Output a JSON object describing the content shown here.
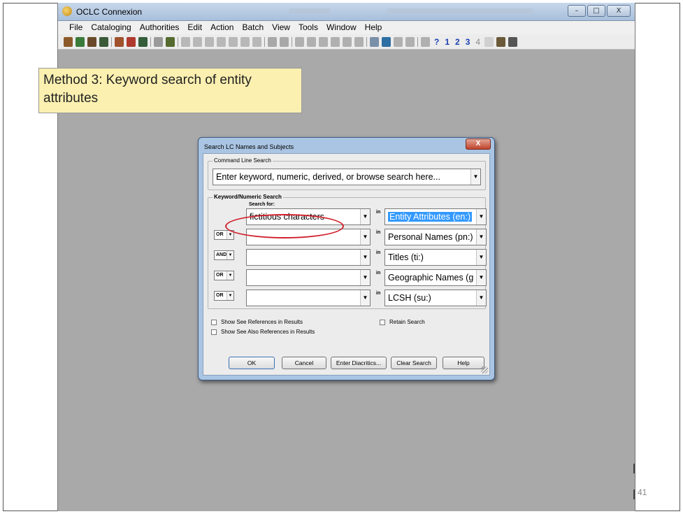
{
  "window": {
    "title": "OCLC Connexion",
    "menu": [
      "File",
      "Cataloging",
      "Authorities",
      "Edit",
      "Action",
      "Batch",
      "View",
      "Tools",
      "Window",
      "Help"
    ],
    "toolbar_numbers": [
      "?",
      "1",
      "2",
      "3",
      "4"
    ],
    "min_label": "–",
    "max_label": "□",
    "close_label": "X"
  },
  "callout": {
    "text": "Method 3:  Keyword search of entity attributes"
  },
  "dialog": {
    "title": "Search LC Names and Subjects",
    "close_label": "X",
    "command_line": {
      "legend": "Command Line Search",
      "placeholder": "Enter keyword, numeric, derived, or browse search here..."
    },
    "keyword": {
      "legend": "Keyword/Numeric Search",
      "search_for_label": "Search for:",
      "in_label": "in",
      "rows": [
        {
          "operator": "",
          "term": "fictitious characters",
          "index": "Entity Attributes (en:)",
          "selected": true
        },
        {
          "operator": "OR",
          "term": "",
          "index": "Personal Names (pn:)"
        },
        {
          "operator": "AND",
          "term": "",
          "index": "Titles (ti:)"
        },
        {
          "operator": "OR",
          "term": "",
          "index": "Geographic Names (g"
        },
        {
          "operator": "OR",
          "term": "",
          "index": "LCSH (su:)"
        }
      ]
    },
    "options": {
      "show_see_refs": "Show See References in Results",
      "show_see_also_refs": "Show See Also References in Results",
      "retain_search": "Retain Search"
    },
    "buttons": {
      "ok": "OK",
      "cancel": "Cancel",
      "diacritics": "Enter Diacritics...",
      "clear": "Clear Search",
      "help": "Help"
    }
  },
  "slide_number": "41"
}
